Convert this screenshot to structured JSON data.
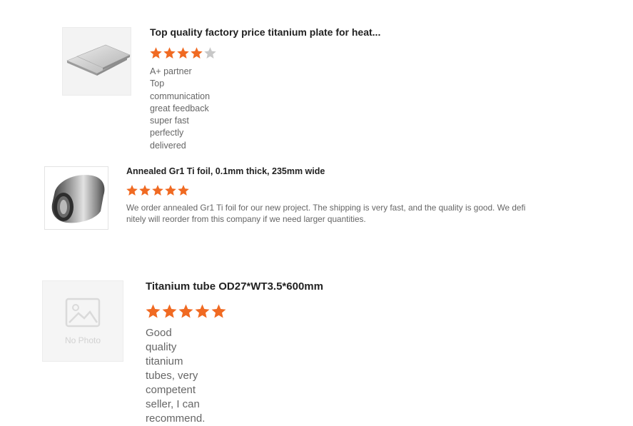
{
  "colors": {
    "star_filled": "#f06a22",
    "star_empty": "#c8c8c8",
    "text": "#666666",
    "title": "#222222"
  },
  "reviews": [
    {
      "title": "Top quality factory price titanium plate for heat...",
      "rating": 4,
      "max_rating": 5,
      "thumbnail": "titanium-plates-photo",
      "comment_lines": [
        "A+ partner",
        "Top communication",
        "great feedback",
        "super fast",
        "perfectly delivered"
      ]
    },
    {
      "title": "Annealed Gr1 Ti foil, 0.1mm thick, 235mm wide",
      "rating": 5,
      "max_rating": 5,
      "thumbnail": "titanium-foil-roll-photo",
      "comment_lines": [
        "We order annealed Gr1 Ti foil for our new project. The shipping is very fast, and the quality is good. We defi",
        "nitely will reorder from this company if we need larger quantities."
      ]
    },
    {
      "title": "Titanium tube OD27*WT3.5*600mm",
      "rating": 5,
      "max_rating": 5,
      "thumbnail": "no-photo-placeholder",
      "thumbnail_label": "No Photo",
      "comment_lines": [
        "Good quality titanium tubes, very competent seller, I can recommend."
      ]
    }
  ]
}
